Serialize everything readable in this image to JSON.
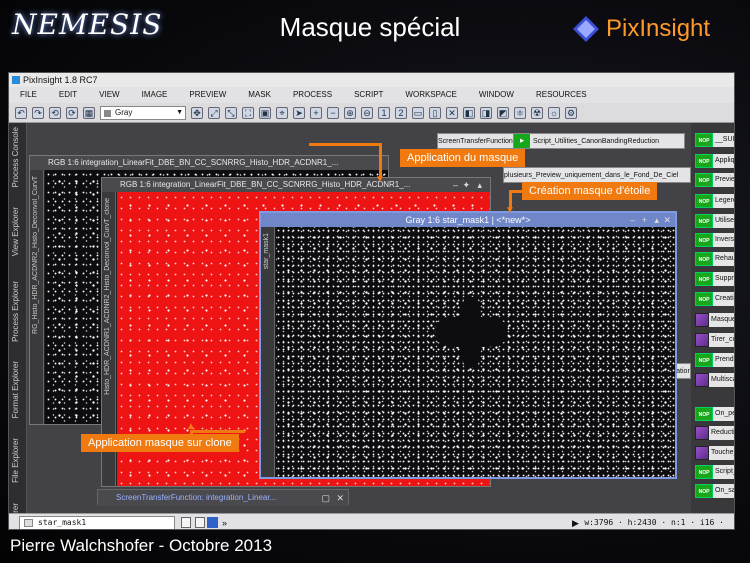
{
  "slide": {
    "logo": "NEMESIS",
    "title": "Masque spécial",
    "brand": "PixInsight",
    "footer": "Pierre Walchshofer - Octobre 2013"
  },
  "app": {
    "window_title": "PixInsight 1.8 RC7",
    "menu": [
      "FILE",
      "EDIT",
      "VIEW",
      "IMAGE",
      "PREVIEW",
      "MASK",
      "PROCESS",
      "SCRIPT",
      "WORKSPACE",
      "WINDOW",
      "RESOURCES"
    ],
    "toolbar": {
      "color_space": "Gray"
    },
    "sidebar_tabs": [
      "Process Console",
      "View Explorer",
      "Process Explorer",
      "Format Explorer",
      "File Explorer",
      "Object Explorer"
    ],
    "windows": {
      "rgb_back": {
        "title": "RGB 1:6 integration_LinearFit_DBE_BN_CC_SCNRRG_Histo_HDR_ACDNR1_...",
        "side_label": "RG_Histo_HDR_ACDNR2_Histo_Deconvol_CurvT"
      },
      "rgb_front": {
        "title": "RGB 1:6 integration_LinearFit_DBE_BN_CC_SCNRRG_Histo_HDR_ACDNR1_...",
        "side_label": "Histo_HDR_ACDNR1_ACDNR2_Histo_Deconvol_CurvT_clone"
      },
      "star_mask": {
        "title": "Gray 1:6 star_mask1 | <*new*>",
        "side_label": "star_mask1"
      },
      "stf": {
        "title": "ScreenTransferFunction: integration_Linear..."
      }
    },
    "workspace_icons": [
      "ScreenTransferFunction",
      "Script_Utilities_CanonBandingReduction",
      "plusieurs_Preview_uniquement_dans_le_Fond_De_Ciel",
      "turation_couleur_po"
    ],
    "process_icons": [
      {
        "label": "__SUIT",
        "kind": "nop"
      },
      {
        "label": "Appliqu",
        "kind": "nop"
      },
      {
        "label": "Preview",
        "kind": "nop"
      },
      {
        "label": "Legere_",
        "kind": "nop"
      },
      {
        "label": "Utiliser_",
        "kind": "nop"
      },
      {
        "label": "Inversio",
        "kind": "nop"
      },
      {
        "label": "Rehauss",
        "kind": "nop"
      },
      {
        "label": "Suppres",
        "kind": "nop"
      },
      {
        "label": "Creation",
        "kind": "nop"
      },
      {
        "label": "Masque_",
        "kind": "proc"
      },
      {
        "label": "Tirer_cu",
        "kind": "proc"
      },
      {
        "label": "Prendre_",
        "kind": "nop"
      },
      {
        "label": "Multisca",
        "kind": "proc"
      },
      {
        "label": "On_peut",
        "kind": "nop"
      },
      {
        "label": "Reductio",
        "kind": "proc"
      },
      {
        "label": "Touche_",
        "kind": "proc"
      },
      {
        "label": "Script_R",
        "kind": "nop"
      },
      {
        "label": "On_sauv",
        "kind": "nop"
      }
    ],
    "status": {
      "view": "star_mask1",
      "info": "w:3796 · h:2430 · n:1 · i16 ·"
    }
  },
  "callouts": {
    "apply_mask": "Application du masque",
    "create_star_mask": "Création masque d'étoile",
    "apply_mask_clone": "Application masque sur clone"
  },
  "colors": {
    "accent": "#f07a10",
    "mask_red": "#ee1414",
    "active_title": "#6f86c8",
    "nop_green": "#17a71a"
  }
}
